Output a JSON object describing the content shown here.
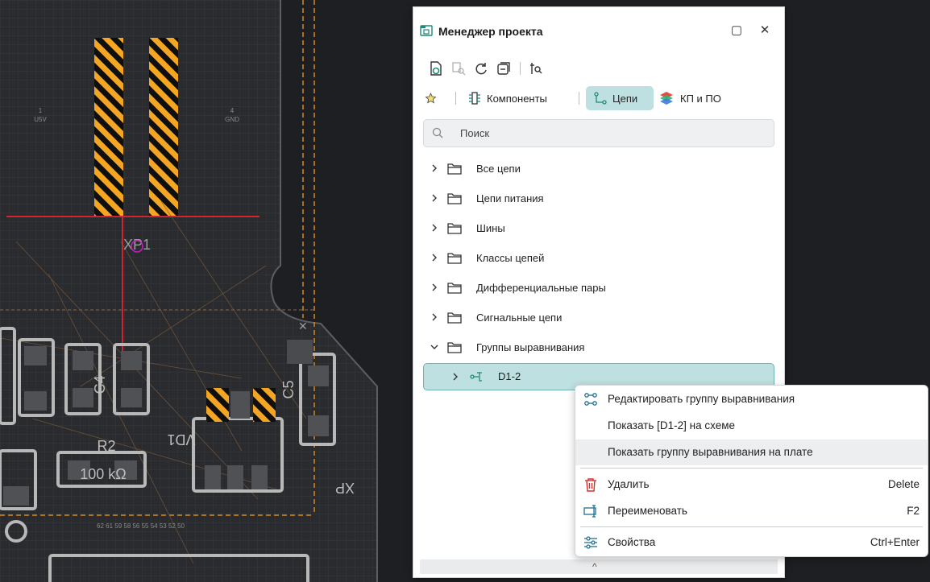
{
  "pcb": {
    "labels": {
      "pin1": "1",
      "pin1_net": "U5V",
      "pin4": "4",
      "pin4_net": "GND",
      "connector": "XP1",
      "r2": "R2",
      "r2_value": "100 kΩ",
      "vd1": "VD1",
      "c4": "C4",
      "c5": "C5",
      "xp_right": "XP",
      "pins_row": "62 61 59 58 56 55 54 53 52 50"
    },
    "colors": {
      "background": "#1e1f22",
      "board_fill": "#27282b",
      "grid": "#3a3c3f",
      "outline": "#d8891e",
      "hazard_yellow": "#f4a623",
      "route_red": "#d2232e",
      "ratsnest": "#7a5a3c",
      "silk": "#b8b8b8",
      "via_magenta": "#c020c0"
    }
  },
  "panel": {
    "title": "Менеджер проекта",
    "title_icon": "project-manager-icon",
    "window_buttons": {
      "maximize": "▢",
      "close": "✕"
    },
    "toolbar": [
      "show-on-schematic-icon",
      "find-icon",
      "refresh-icon",
      "collapse-all-icon",
      "filter-icon"
    ],
    "tabs": [
      {
        "label": "",
        "icon": "star-icon"
      },
      {
        "label": "Компоненты",
        "icon": "component-icon"
      },
      {
        "label": "Цепи",
        "icon": "net-icon",
        "active": true
      },
      {
        "label": "КП и ПО",
        "icon": "layers-icon"
      }
    ],
    "search": {
      "placeholder": "Поиск"
    },
    "tree": [
      {
        "label": "Все цепи",
        "expanded": false
      },
      {
        "label": "Цепи питания",
        "expanded": false
      },
      {
        "label": "Шины",
        "expanded": false
      },
      {
        "label": "Классы цепей",
        "expanded": false
      },
      {
        "label": "Дифференциальные пары",
        "expanded": false
      },
      {
        "label": "Сигнальные цепи",
        "expanded": false
      },
      {
        "label": "Группы выравнивания",
        "expanded": true
      },
      {
        "label": "D1-2",
        "selected": true,
        "child": true
      }
    ],
    "scroll_indicator": "^",
    "accent": "#bfe0e0"
  },
  "context_menu": {
    "items": [
      {
        "label": "Редактировать группу выравнивания",
        "icon": "edit-group-icon",
        "shortcut": ""
      },
      {
        "label": "Показать [D1-2] на схеме",
        "icon": "",
        "shortcut": ""
      },
      {
        "label": "Показать группу выравнивания на плате",
        "icon": "",
        "shortcut": "",
        "hover": true
      },
      {
        "label": "Удалить",
        "icon": "trash-icon",
        "shortcut": "Delete"
      },
      {
        "label": "Переименовать",
        "icon": "rename-icon",
        "shortcut": "F2"
      },
      {
        "label": "Свойства",
        "icon": "properties-icon",
        "shortcut": "Ctrl+Enter"
      }
    ],
    "danger_color": "#d0312d"
  }
}
